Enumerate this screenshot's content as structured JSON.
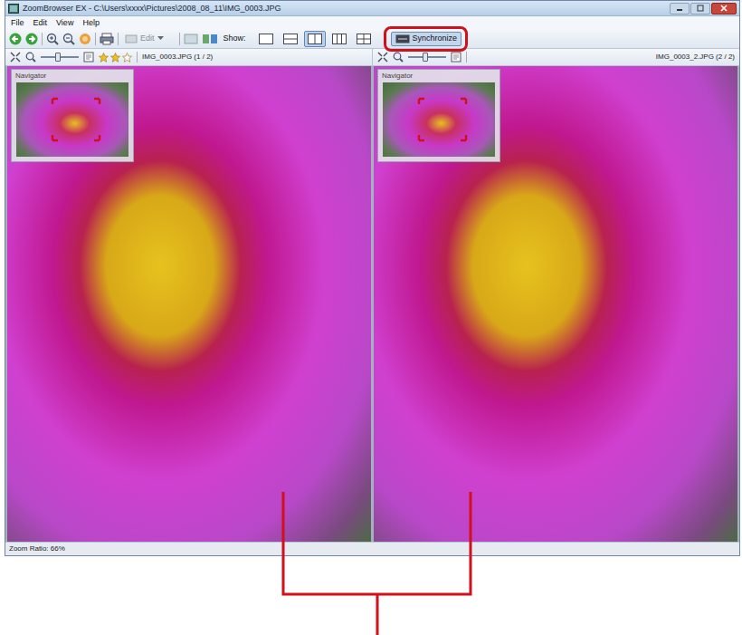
{
  "window": {
    "title": "ZoomBrowser EX - C:\\Users\\xxxx\\Pictures\\2008_08_11\\IMG_0003.JPG"
  },
  "menu": [
    "File",
    "Edit",
    "View",
    "Help"
  ],
  "toolbar": {
    "edit": {
      "label": "Edit",
      "disabled": true
    },
    "show_label": "Show:",
    "layouts": [
      {
        "selected": false
      },
      {
        "selected": false
      },
      {
        "selected": true
      },
      {
        "selected": false
      },
      {
        "selected": false
      }
    ],
    "synchronize": {
      "label": "Synchronize",
      "on": true
    }
  },
  "panels": [
    {
      "filename": "IMG_0003.JPG (1 / 2)",
      "navigator": "Navigator",
      "zoom_level": 0.45,
      "stars": 2
    },
    {
      "filename": "IMG_0003_2.JPG (2 / 2)",
      "navigator": "Navigator",
      "zoom_level": 0.45
    }
  ],
  "status_bar": "Zoom Ratio: 66%"
}
